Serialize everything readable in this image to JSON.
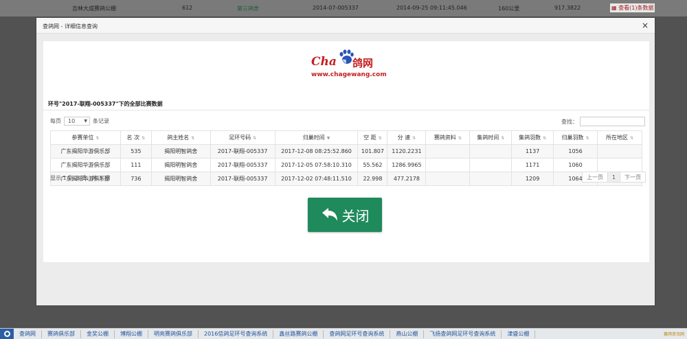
{
  "background_row": {
    "club": "吉林大成赛鸽公棚",
    "rank": "612",
    "award": "第三鸽舍",
    "ring": "2014-07-005337",
    "time": "2014-09-25 09:11:45.046",
    "distance": "160公里",
    "speed": "917.3822",
    "view": "查看(1)条数据"
  },
  "modal": {
    "title": "查鸽网 - 详细信息查询",
    "close_symbol": "×",
    "logo": {
      "cha": "Cha",
      "paw_text": "鸽",
      "ge": "鸽网",
      "url": "www.chagewang.com"
    },
    "heading": "环号\"2017-联翔-005337\"下的全部比赛数据",
    "length": {
      "prefix": "每页",
      "value": "10",
      "suffix": "条记录"
    },
    "search_label": "查找：",
    "table": {
      "headers": [
        "参赛单位",
        "名 次",
        "鸽主姓名",
        "足环号码",
        "归巢时间",
        "空 距",
        "分 速",
        "赛鸽资料",
        "集鸽时间",
        "集鸽羽数",
        "归巢羽数",
        "所在地区"
      ],
      "rows": [
        [
          "广东揭阳华游俱乐部",
          "535",
          "揭阳明智鸽舍",
          "2017-联翔-005337",
          "2017-12-08 08:25:52.860",
          "101.807",
          "1120.2231",
          "",
          "",
          "1137",
          "1056",
          ""
        ],
        [
          "广东揭阳华游俱乐部",
          "111",
          "揭阳明智鸽舍",
          "2017-联翔-005337",
          "2017-12-05 07:58:10.310",
          "55.562",
          "1286.9965",
          "",
          "",
          "1171",
          "1060",
          ""
        ],
        [
          "广东揭阳华游俱乐部",
          "736",
          "揭阳明智鸽舍",
          "2017-联翔-005337",
          "2017-12-02 07:48:11.510",
          "22.998",
          "477.2178",
          "",
          "",
          "1209",
          "1064",
          ""
        ]
      ]
    },
    "info": "显示 1 到 3 项，共 3 项",
    "pager": {
      "prev": "上一页",
      "current": "1",
      "next": "下一页"
    },
    "close_button": "关闭"
  },
  "footer": {
    "items": [
      "查鸽网",
      "赛鸽俱乐部",
      "金奖公棚",
      "博翔公棚",
      "明亮赛鸽俱乐部",
      "2016信鸽足环号查询系统",
      "鑫丝路赛鸽公棚",
      "查鸽网足环号查询系统",
      "燕山公棚",
      "飞扬查鸽网足环号查询系统",
      "津盛公棚"
    ],
    "watermark": "赛鸽资讯网"
  },
  "colors": {
    "accent_green": "#1f8a5b",
    "brand_red": "#c41f1f",
    "link_blue": "#1e4f99"
  }
}
